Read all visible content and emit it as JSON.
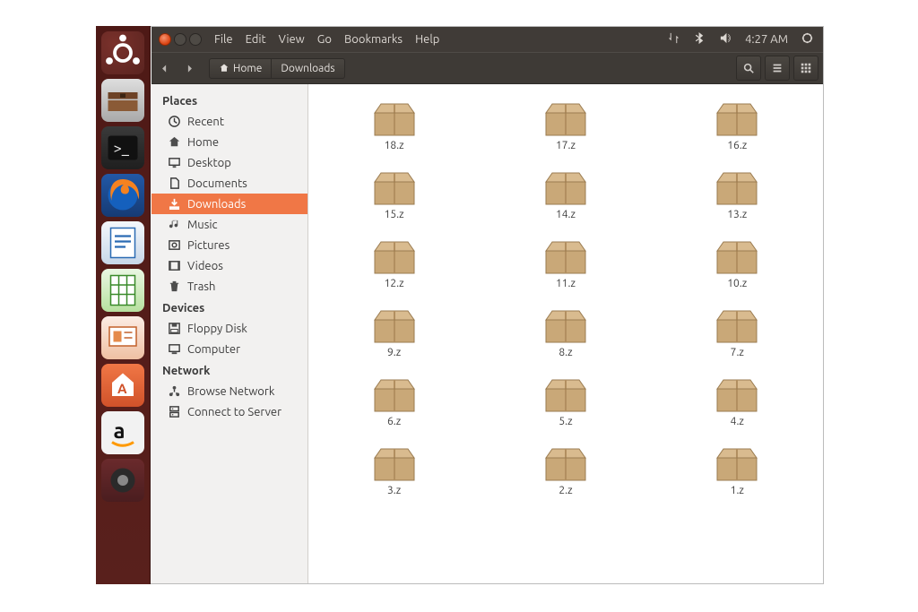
{
  "topbar": {
    "menus": [
      "File",
      "Edit",
      "View",
      "Go",
      "Bookmarks",
      "Help"
    ],
    "time": "4:27 AM"
  },
  "toolbar": {
    "crumbs": [
      "Home",
      "Downloads"
    ]
  },
  "sidebar": {
    "sections": [
      {
        "title": "Places",
        "items": [
          {
            "icon": "clock-icon",
            "label": "Recent"
          },
          {
            "icon": "home-icon",
            "label": "Home"
          },
          {
            "icon": "desktop-icon",
            "label": "Desktop"
          },
          {
            "icon": "document-icon",
            "label": "Documents"
          },
          {
            "icon": "download-icon",
            "label": "Downloads",
            "active": true
          },
          {
            "icon": "music-icon",
            "label": "Music"
          },
          {
            "icon": "pictures-icon",
            "label": "Pictures"
          },
          {
            "icon": "videos-icon",
            "label": "Videos"
          },
          {
            "icon": "trash-icon",
            "label": "Trash"
          }
        ]
      },
      {
        "title": "Devices",
        "items": [
          {
            "icon": "floppy-icon",
            "label": "Floppy Disk"
          },
          {
            "icon": "computer-icon",
            "label": "Computer"
          }
        ]
      },
      {
        "title": "Network",
        "items": [
          {
            "icon": "network-icon",
            "label": "Browse Network"
          },
          {
            "icon": "server-icon",
            "label": "Connect to Server"
          }
        ]
      }
    ]
  },
  "files": [
    "18.z",
    "17.z",
    "16.z",
    "15.z",
    "14.z",
    "13.z",
    "12.z",
    "11.z",
    "10.z",
    "9.z",
    "8.z",
    "7.z",
    "6.z",
    "5.z",
    "4.z",
    "3.z",
    "2.z",
    "1.z"
  ],
  "launcher": [
    {
      "name": "dash",
      "label": "Dash"
    },
    {
      "name": "fm",
      "label": "Files"
    },
    {
      "name": "term",
      "label": "Terminal"
    },
    {
      "name": "ff",
      "label": "Firefox"
    },
    {
      "name": "writer",
      "label": "LibreOffice Writer"
    },
    {
      "name": "calc",
      "label": "LibreOffice Calc"
    },
    {
      "name": "impress",
      "label": "LibreOffice Impress"
    },
    {
      "name": "sw",
      "label": "Ubuntu Software"
    },
    {
      "name": "amz",
      "label": "Amazon"
    },
    {
      "name": "sys",
      "label": "System Settings"
    }
  ]
}
